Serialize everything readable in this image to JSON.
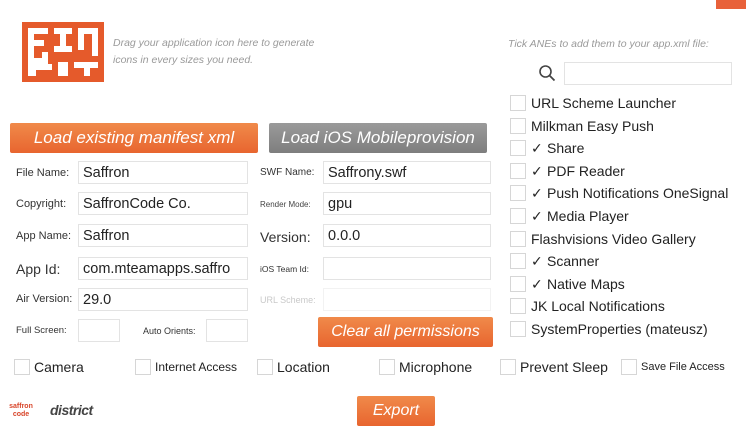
{
  "hints": {
    "drag_icon": "Drag your application icon here to generate icons in every sizes you need.",
    "ane_tick": "Tick ANEs to add them to your app.xml file:"
  },
  "buttons": {
    "load_manifest": "Load existing manifest xml",
    "load_provision": "Load iOS Mobileprovision",
    "clear_permissions": "Clear all permissions",
    "export": "Export"
  },
  "fields": {
    "file_name": {
      "label": "File Name:",
      "value": "Saffron"
    },
    "copyright": {
      "label": "Copyright:",
      "value": "SaffronCode Co."
    },
    "app_name": {
      "label": "App Name:",
      "value": "Saffron"
    },
    "app_id": {
      "label": "App Id:",
      "value": "com.mteamapps.saffro"
    },
    "air_version": {
      "label": "Air Version:",
      "value": "29.0"
    },
    "full_screen": {
      "label": "Full Screen:",
      "value": ""
    },
    "auto_orients": {
      "label": "Auto Orients:",
      "value": ""
    },
    "swf_name": {
      "label": "SWF Name:",
      "value": "Saffrony.swf"
    },
    "render_mode": {
      "label": "Render Mode:",
      "value": "gpu"
    },
    "version": {
      "label": "Version:",
      "value": "0.0.0"
    },
    "ios_team_id": {
      "label": "iOS Team Id:",
      "value": ""
    },
    "url_scheme": {
      "label": "URL Scheme:",
      "value": ""
    }
  },
  "ane_list": [
    {
      "name": "URL Scheme Launcher",
      "checked": false
    },
    {
      "name": "Milkman Easy Push",
      "checked": false
    },
    {
      "name": "Share",
      "checked": true
    },
    {
      "name": "PDF Reader",
      "checked": true
    },
    {
      "name": "Push Notifications OneSignal",
      "checked": true
    },
    {
      "name": "Media Player",
      "checked": true
    },
    {
      "name": "Flashvisions Video Gallery",
      "checked": false
    },
    {
      "name": "Scanner",
      "checked": true
    },
    {
      "name": "Native Maps",
      "checked": true
    },
    {
      "name": "JK Local Notifications",
      "checked": false
    },
    {
      "name": "SystemProperties (mateusz)",
      "checked": false
    }
  ],
  "permissions": [
    {
      "name": "Camera"
    },
    {
      "name": "Internet Access"
    },
    {
      "name": "Location"
    },
    {
      "name": "Microphone"
    },
    {
      "name": "Prevent Sleep"
    },
    {
      "name": "Save File Access"
    }
  ],
  "footer": {
    "saffron_logo": "saffron code",
    "district_logo": "district"
  },
  "colors": {
    "accent": "#e8652f",
    "gray_button": "#8a8a8a"
  },
  "icons": {
    "check": "✓",
    "search": "search-icon"
  }
}
